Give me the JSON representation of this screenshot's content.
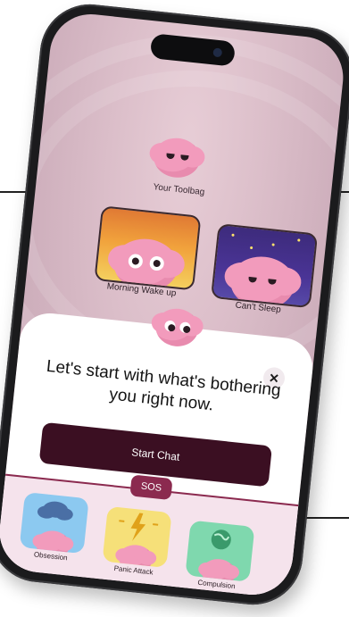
{
  "toolbag": {
    "label": "Your Toolbag"
  },
  "cards": [
    {
      "label": "Morning Wake up"
    },
    {
      "label": "Can't Sleep"
    }
  ],
  "modal": {
    "headline": "Let's start with what's bothering you right now.",
    "close_symbol": "✕",
    "start_button": "Start Chat"
  },
  "sos": {
    "badge": "SOS",
    "items": [
      {
        "label": "Obsession",
        "icon": "cloud-icon"
      },
      {
        "label": "Panic Attack",
        "icon": "bolt-icon"
      },
      {
        "label": "Compulsion",
        "icon": "globe-icon"
      }
    ]
  },
  "colors": {
    "accent": "#3b0f22",
    "sos": "#8b2a4f",
    "brain": "#f29bbc"
  }
}
